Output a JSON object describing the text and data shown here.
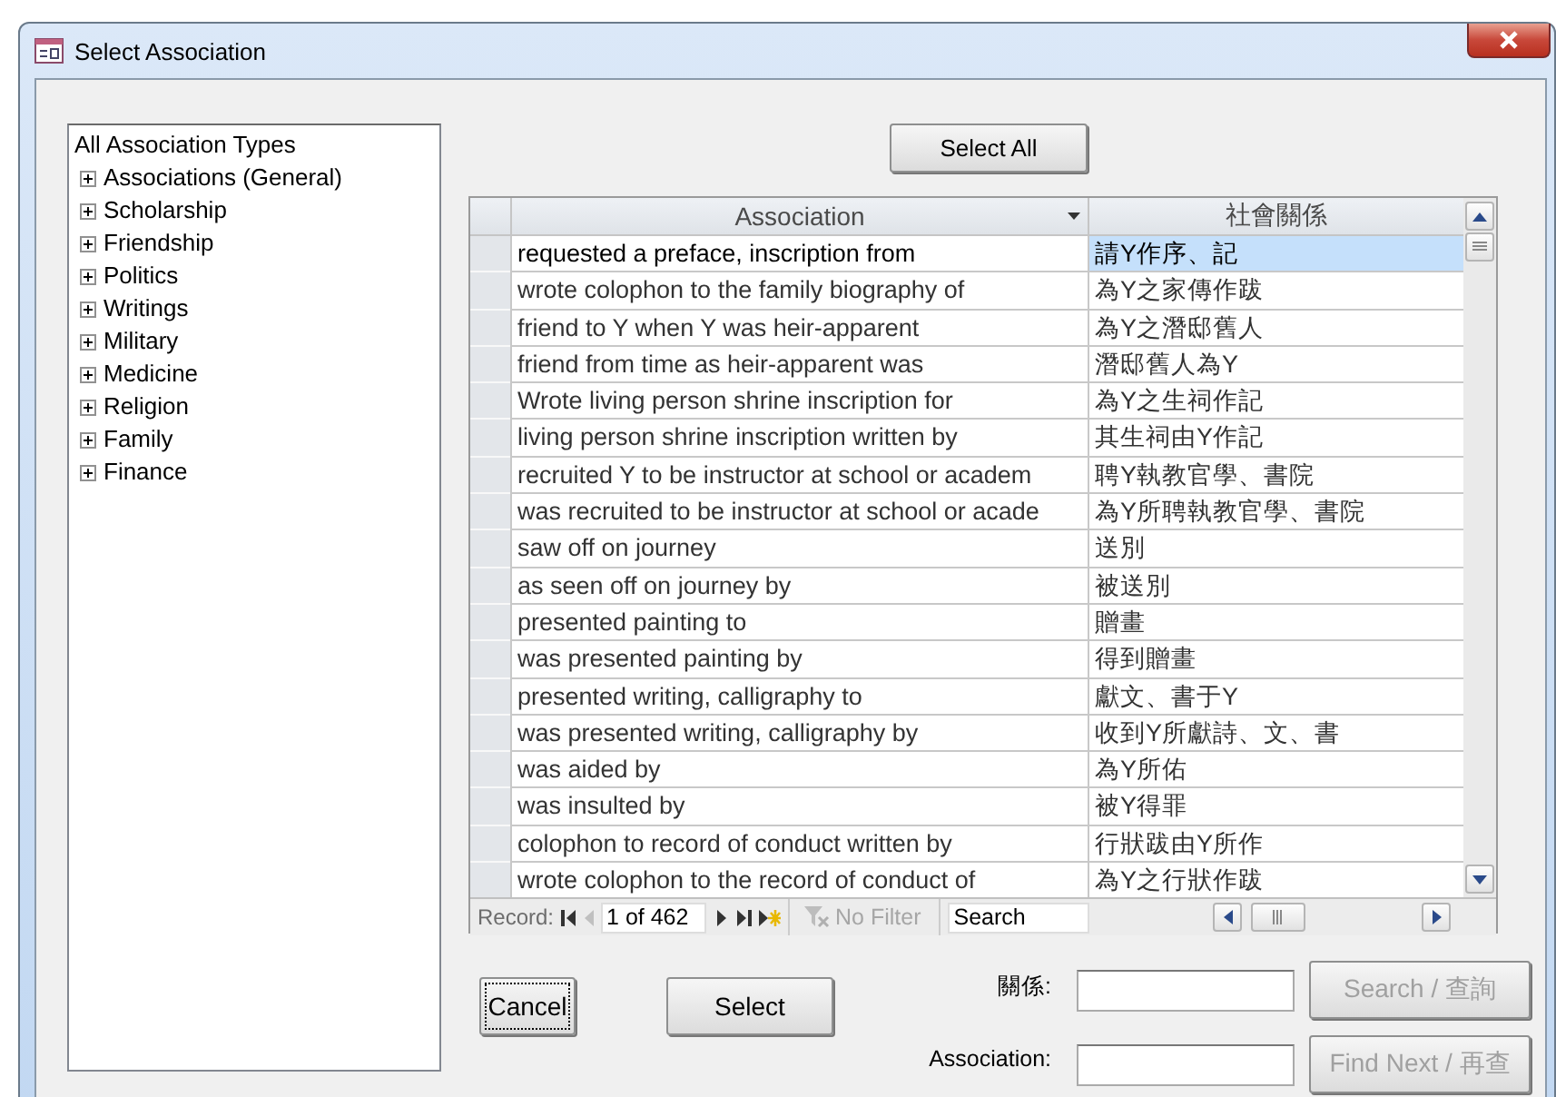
{
  "window": {
    "title": "Select Association"
  },
  "tree": {
    "root": "All Association Types",
    "items": [
      {
        "label": "Associations (General)",
        "expanded": false
      },
      {
        "label": "Scholarship",
        "expanded": false
      },
      {
        "label": "Friendship",
        "expanded": false
      },
      {
        "label": "Politics",
        "expanded": false
      },
      {
        "label": "Writings",
        "expanded": false
      },
      {
        "label": "Military",
        "expanded": false
      },
      {
        "label": "Medicine",
        "expanded": false
      },
      {
        "label": "Religion",
        "expanded": false
      },
      {
        "label": "Family",
        "expanded": false
      },
      {
        "label": "Finance",
        "expanded": false
      }
    ]
  },
  "select_all_button": "Select All",
  "table": {
    "columns": [
      "Association",
      "社會關係"
    ],
    "rows": [
      {
        "association": "requested a preface, inscription from",
        "relation": "請Y作序、記",
        "selected": true
      },
      {
        "association": "wrote colophon to the family biography of",
        "relation": "為Y之家傳作跋",
        "selected": false
      },
      {
        "association": "friend to Y when Y was heir-apparent",
        "relation": "為Y之潛邸舊人",
        "selected": false
      },
      {
        "association": "friend from time as heir-apparent was",
        "relation": "潛邸舊人為Y",
        "selected": false
      },
      {
        "association": "Wrote living person shrine inscription for",
        "relation": "為Y之生祠作記",
        "selected": false
      },
      {
        "association": "living person shrine inscription written by",
        "relation": "其生祠由Y作記",
        "selected": false
      },
      {
        "association": "recruited Y to be instructor at school or academ",
        "relation": "聘Y執教官學、書院",
        "selected": false
      },
      {
        "association": "was recruited to be instructor at school or acade",
        "relation": "為Y所聘執教官學、書院",
        "selected": false
      },
      {
        "association": "saw off on journey",
        "relation": "送別",
        "selected": false
      },
      {
        "association": "as seen off on journey by",
        "relation": "被送別",
        "selected": false
      },
      {
        "association": "presented painting to",
        "relation": "贈畫",
        "selected": false
      },
      {
        "association": "was presented painting by",
        "relation": "得到贈畫",
        "selected": false
      },
      {
        "association": "presented writing, calligraphy to",
        "relation": "獻文、書于Y",
        "selected": false
      },
      {
        "association": "was presented writing, calligraphy by",
        "relation": "收到Y所獻詩、文、書",
        "selected": false
      },
      {
        "association": "was aided by",
        "relation": "為Y所佑",
        "selected": false
      },
      {
        "association": "was insulted by",
        "relation": "被Y得罪",
        "selected": false
      },
      {
        "association": "colophon to record of conduct written by",
        "relation": "行狀跋由Y所作",
        "selected": false
      },
      {
        "association": "wrote colophon to the record of conduct of",
        "relation": "為Y之行狀作跋",
        "selected": false
      }
    ]
  },
  "navigator": {
    "label": "Record:",
    "position": "1 of 462",
    "filter": "No Filter",
    "search_placeholder": "Search"
  },
  "buttons": [
    {
      "label": "Cancel",
      "focused": true
    },
    {
      "label": "Select",
      "focused": false
    }
  ],
  "search": [
    {
      "label": "關係:",
      "button": "Search / 查詢",
      "disabled": true
    },
    {
      "label": "Association:",
      "button": "Find Next / 再查",
      "disabled": true
    }
  ]
}
